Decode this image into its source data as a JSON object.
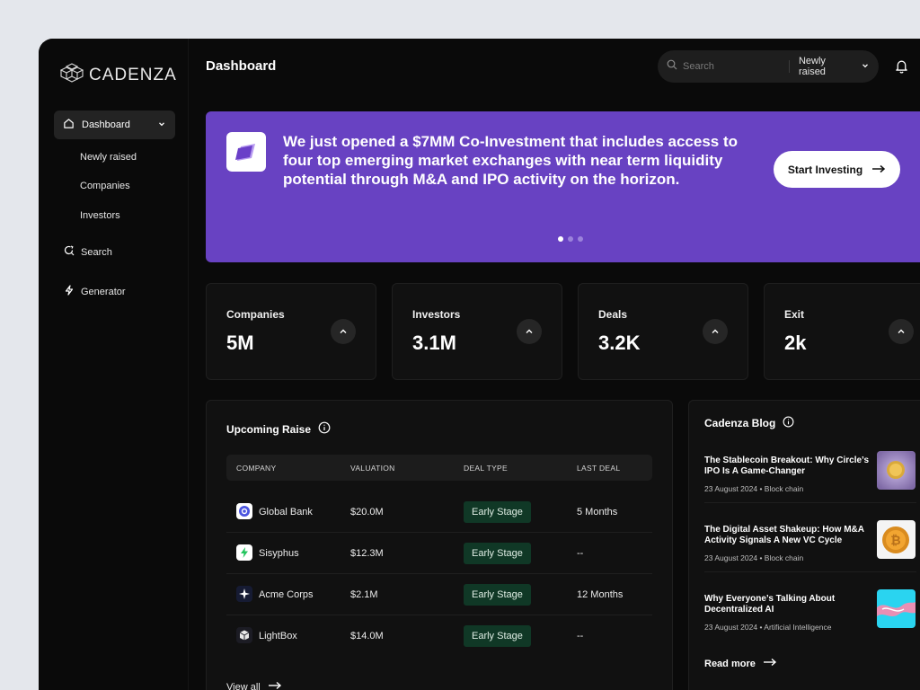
{
  "brand": {
    "name": "CADENZA"
  },
  "sidebar": {
    "dashboard_label": "Dashboard",
    "sub_items": [
      {
        "label": "Newly raised"
      },
      {
        "label": "Companies"
      },
      {
        "label": "Investors"
      }
    ],
    "items": [
      {
        "label": "Search",
        "icon": "search-refresh-icon"
      },
      {
        "label": "Generator",
        "icon": "lightning-icon"
      }
    ]
  },
  "header": {
    "title": "Dashboard",
    "search_placeholder": "Search",
    "filter_label": "Newly raised"
  },
  "banner": {
    "text": "We just opened a $7MM Co-Investment that includes access to four top emerging market exchanges with near term liquidity potential through M&A and IPO activity on the horizon.",
    "cta_label": "Start Investing",
    "slides": 3,
    "active_slide": 1,
    "color": "#6842c2"
  },
  "stats": [
    {
      "label": "Companies",
      "value": "5M"
    },
    {
      "label": "Investors",
      "value": "3.1M"
    },
    {
      "label": "Deals",
      "value": "3.2K"
    },
    {
      "label": "Exit",
      "value": "2k"
    }
  ],
  "upcoming_raise": {
    "title": "Upcoming Raise",
    "columns": [
      "COMPANY",
      "VALUATION",
      "DEAL TYPE",
      "LAST DEAL"
    ],
    "rows": [
      {
        "company": "Global Bank",
        "valuation": "$20.0M",
        "deal_type": "Early Stage",
        "last_deal": "5 Months",
        "icon": "global-bank-logo"
      },
      {
        "company": "Sisyphus",
        "valuation": "$12.3M",
        "deal_type": "Early Stage",
        "last_deal": "--",
        "icon": "sisyphus-logo"
      },
      {
        "company": "Acme Corps",
        "valuation": "$2.1M",
        "deal_type": "Early Stage",
        "last_deal": "12 Months",
        "icon": "acme-logo"
      },
      {
        "company": "LightBox",
        "valuation": "$14.0M",
        "deal_type": "Early Stage",
        "last_deal": "--",
        "icon": "lightbox-logo"
      }
    ],
    "view_all_label": "View all"
  },
  "blog": {
    "title": "Cadenza Blog",
    "posts": [
      {
        "title": "The Stablecoin Breakout: Why Circle’s IPO Is A Game-Changer",
        "date": "23 August 2024",
        "category": "Block chain",
        "meta": "23 August 2024 • Block chain"
      },
      {
        "title": "The Digital Asset Shakeup: How M&A Activity Signals A New VC Cycle",
        "date": "23 August 2024",
        "category": "Block chain",
        "meta": "23 August 2024 • Block chain"
      },
      {
        "title": "Why Everyone’s Talking About Decentralized AI",
        "date": "23 August 2024",
        "category": "Artificial Intelligence",
        "meta": "23 August 2024 • Artificial Intelligence"
      }
    ],
    "read_more_label": "Read more"
  },
  "colors": {
    "background": "#0a0a0a",
    "accent": "#6842c2",
    "badge_bg": "#103826",
    "page_bg": "#e4e7ec"
  }
}
